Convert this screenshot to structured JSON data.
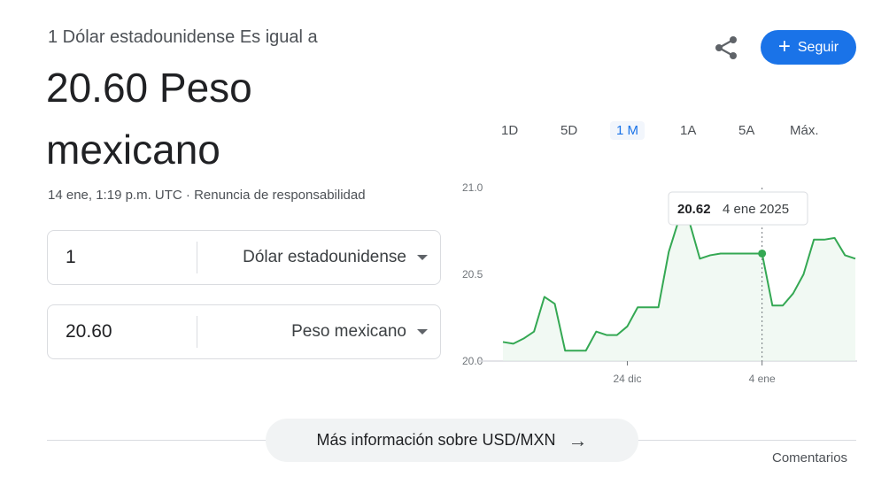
{
  "header": {
    "equals_label": "1 Dólar estadounidense Es igual a",
    "result_line1": "20.60 Peso",
    "result_line2": "mexicano",
    "timestamp": "14 ene, 1:19 p.m. UTC",
    "separator": " · ",
    "disclaimer": "Renuncia de responsabilidad"
  },
  "actions": {
    "follow_label": "Seguir",
    "share_icon": "share-icon",
    "plus_glyph": "+"
  },
  "converter": [
    {
      "value": "1",
      "currency": "Dólar estadounidense"
    },
    {
      "value": "20.60",
      "currency": "Peso mexicano"
    }
  ],
  "range_tabs": [
    {
      "label": "1D",
      "active": false
    },
    {
      "label": "5D",
      "active": false
    },
    {
      "label": "1 M",
      "active": true
    },
    {
      "label": "1A",
      "active": false
    },
    {
      "label": "5A",
      "active": false
    },
    {
      "label": "Máx.",
      "active": false
    }
  ],
  "more_info": {
    "label": "Más información sobre USD/MXN",
    "arrow": "→"
  },
  "feedback": "Comentarios",
  "chart_data": {
    "type": "line",
    "title": "",
    "xlabel": "",
    "ylabel": "",
    "ylim": [
      20.0,
      21.0
    ],
    "yticks": [
      "21.0",
      "20.5",
      "20.0"
    ],
    "xticks": [
      {
        "label": "24 dic",
        "index": 12
      },
      {
        "label": "4 ene",
        "index": 25
      }
    ],
    "line_color": "#34a853",
    "grid": false,
    "values": [
      20.11,
      20.1,
      20.13,
      20.17,
      20.37,
      20.33,
      20.06,
      20.06,
      20.06,
      20.17,
      20.15,
      20.15,
      20.2,
      20.31,
      20.31,
      20.31,
      20.63,
      20.82,
      20.8,
      20.59,
      20.61,
      20.62,
      20.62,
      20.62,
      20.62,
      20.62,
      20.32,
      20.32,
      20.39,
      20.5,
      20.7,
      20.7,
      20.71,
      20.61,
      20.59
    ],
    "selected": {
      "index": 25,
      "value": "20.62",
      "date": "4 ene 2025"
    }
  }
}
